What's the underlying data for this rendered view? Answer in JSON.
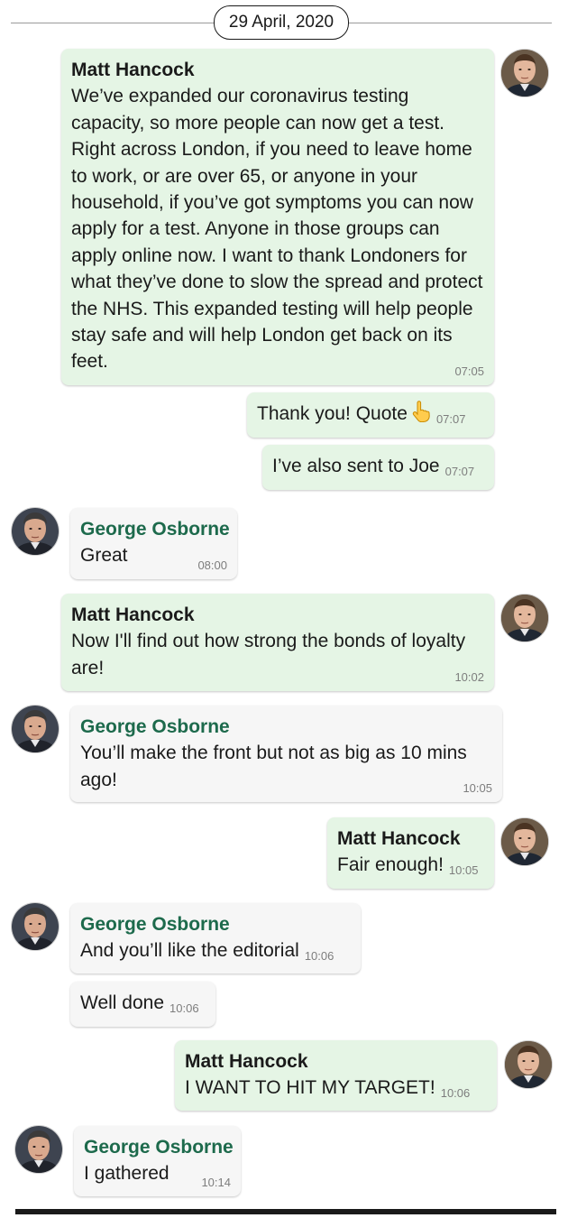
{
  "date_divider": "29 April, 2020",
  "messages": [
    {
      "sender": "Matt Hancock",
      "text": "We’ve expanded our coronavirus testing capacity, so more people can now get a test. Right across London, if you need to leave home to work, or are over 65, or anyone in your household, if you’ve got symptoms you can now apply for a test. Anyone in those groups can apply online now. I want to thank Londoners for what they’ve done to slow the spread and protect the NHS. This expanded testing will help people stay safe and will help London get back on its feet.",
      "time": "07:05"
    },
    {
      "sender": "",
      "text": "Thank you! Quote",
      "icon": "pointing-hand-icon",
      "time": "07:07"
    },
    {
      "sender": "",
      "text": "I’ve also sent to Joe",
      "time": "07:07"
    },
    {
      "sender": "George Osborne",
      "text": "Great",
      "time": "08:00"
    },
    {
      "sender": "Matt Hancock",
      "text": "Now I'll find out how strong the bonds of loyalty are!",
      "time": "10:02"
    },
    {
      "sender": "George Osborne",
      "text": "You’ll make the front but not as big as 10 mins ago!",
      "time": "10:05"
    },
    {
      "sender": "Matt Hancock",
      "text": "Fair enough!",
      "time": "10:05"
    },
    {
      "sender": "George Osborne",
      "text": "And you’ll like the editorial",
      "time": "10:06"
    },
    {
      "sender": "",
      "text": "Well done",
      "time": "10:06"
    },
    {
      "sender": "Matt Hancock",
      "text": "I WANT TO HIT MY TARGET!",
      "time": "10:06"
    },
    {
      "sender": "George Osborne",
      "text": "I gathered",
      "time": "10:14"
    }
  ],
  "colors": {
    "outgoing_bubble": "#e5f5e5",
    "incoming_bubble": "#f6f6f6",
    "incoming_name": "#1d6a4c",
    "timestamp": "#7d7d7d"
  }
}
